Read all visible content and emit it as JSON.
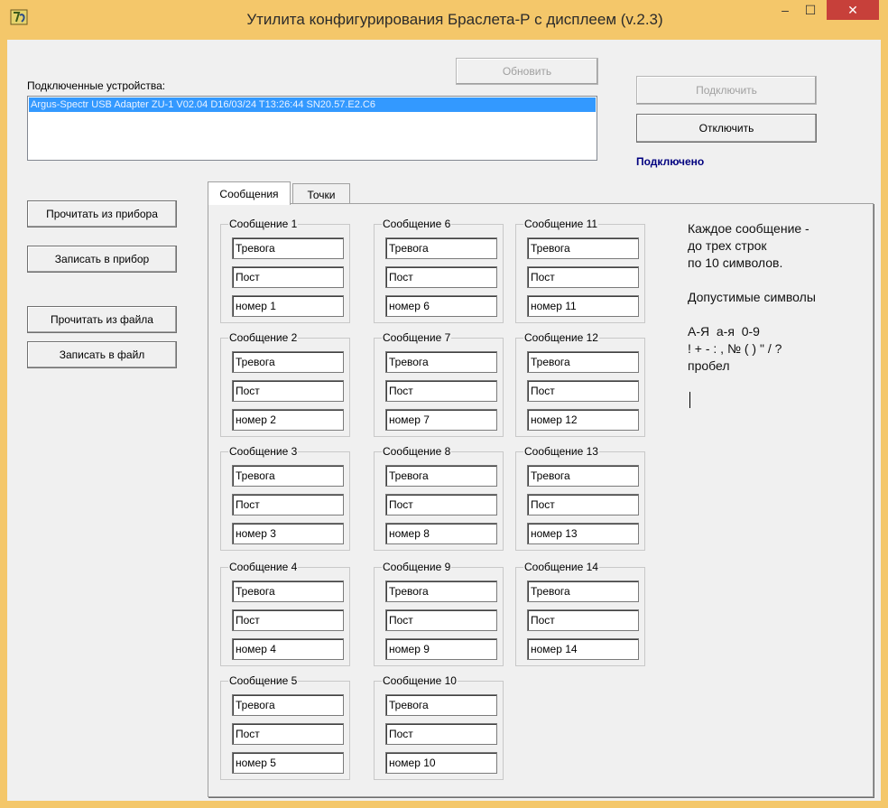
{
  "window": {
    "title": "Утилита конфигурирования Браслета-Р  с дисплеем (v.2.3)",
    "icon": "app-icon",
    "controls": {
      "minimize": "–",
      "maximize": "☐",
      "close": "✕"
    }
  },
  "devices": {
    "label": "Подключенные устройства:",
    "items": [
      "Argus-Spectr USB Adapter ZU-1 V02.04 D16/03/24 T13:26:44 SN20.57.E2.C6"
    ],
    "selected_index": 0
  },
  "buttons": {
    "refresh": "Обновить",
    "connect": "Подключить",
    "disconnect": "Отключить",
    "read_device": "Прочитать из прибора",
    "write_device": "Записать в прибор",
    "read_file": "Прочитать из файла",
    "write_file": "Записать в файл"
  },
  "status": "Подключено",
  "tabs": [
    {
      "label": "Сообщения",
      "active": true
    },
    {
      "label": "Точки",
      "active": false
    }
  ],
  "messages": [
    {
      "title": "Сообщение 1",
      "lines": [
        "Тревога",
        "Пост",
        "номер 1"
      ]
    },
    {
      "title": "Сообщение 2",
      "lines": [
        "Тревога",
        "Пост",
        "номер 2"
      ]
    },
    {
      "title": "Сообщение 3",
      "lines": [
        "Тревога",
        "Пост",
        "номер 3"
      ]
    },
    {
      "title": "Сообщение 4",
      "lines": [
        "Тревога",
        "Пост",
        "номер 4"
      ]
    },
    {
      "title": "Сообщение 5",
      "lines": [
        "Тревога",
        "Пост",
        "номер 5"
      ]
    },
    {
      "title": "Сообщение 6",
      "lines": [
        "Тревога",
        "Пост",
        "номер 6"
      ]
    },
    {
      "title": "Сообщение 7",
      "lines": [
        "Тревога",
        "Пост",
        "номер 7"
      ]
    },
    {
      "title": "Сообщение 8",
      "lines": [
        "Тревога",
        "Пост",
        "номер 8"
      ]
    },
    {
      "title": "Сообщение 9",
      "lines": [
        "Тревога",
        "Пост",
        "номер 9"
      ]
    },
    {
      "title": "Сообщение 10",
      "lines": [
        "Тревога",
        "Пост",
        "номер 10"
      ]
    },
    {
      "title": "Сообщение 11",
      "lines": [
        "Тревога",
        "Пост",
        "номер 11"
      ]
    },
    {
      "title": "Сообщение 12",
      "lines": [
        "Тревога",
        "Пост",
        "номер 12"
      ]
    },
    {
      "title": "Сообщение 13",
      "lines": [
        "Тревога",
        "Пост",
        "номер 13"
      ]
    },
    {
      "title": "Сообщение 14",
      "lines": [
        "Тревога",
        "Пост",
        "номер 14"
      ]
    }
  ],
  "help_text": "Каждое сообщение -\nдо трех строк\nпо 10 символов.\n\nДопустимые символы\n\nА-Я  а-я  0-9\n! + - : , № ( ) \" / ?\nпробел",
  "colors": {
    "title_bar": "#f4c76a",
    "selection": "#3399ff",
    "status": "#00007f",
    "close_button": "#c7403a"
  }
}
